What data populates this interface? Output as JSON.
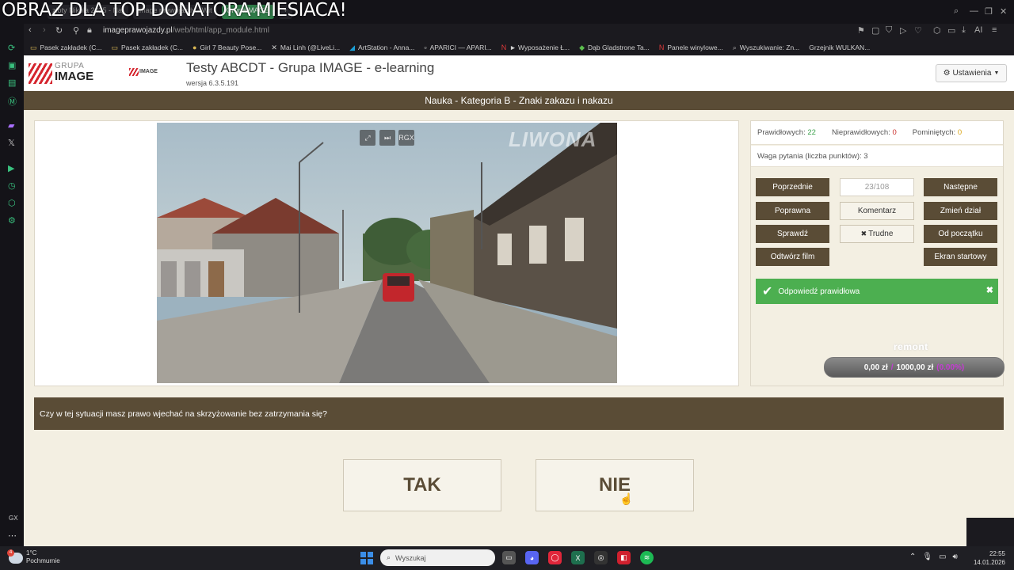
{
  "overlay": {
    "title": "OBRAZ DLA TOP DONATORA MIESIACA!"
  },
  "browser": {
    "tabs": [
      {
        "label": "złoty Nikola 2025 - Naj"
      },
      {
        "label": "image prawojazdy - Wit"
      },
      {
        "label": "GrupaIMAGE"
      }
    ],
    "url_domain": "imageprawojazdy.pl",
    "url_path": "/web/html/app_module.html",
    "ai_label": "AI"
  },
  "bookmarks": [
    {
      "label": "Pasek zakładek (C...",
      "icon": "folder-icon"
    },
    {
      "label": "Pasek zakładek (C...",
      "icon": "folder-icon"
    },
    {
      "label": "Girl 7 Beauty Pose...",
      "icon": "site-icon"
    },
    {
      "label": "Mai Linh (@LiveLi...",
      "icon": "x-icon"
    },
    {
      "label": "ArtStation - Anna...",
      "icon": "artstation-icon"
    },
    {
      "label": "APARICI — APARI...",
      "icon": "site-icon"
    },
    {
      "label": "► Wyposażenie Ł...",
      "icon": "n-icon"
    },
    {
      "label": "Dąb Gladstrone Ta...",
      "icon": "diamond-icon"
    },
    {
      "label": "Panele winylowe...",
      "icon": "n-icon"
    },
    {
      "label": "Wyszukiwanie: Zn...",
      "icon": "search-icon"
    },
    {
      "label": "Grzejnik WULKAN...",
      "icon": "site-icon"
    }
  ],
  "header": {
    "logo_top": "GRUPA",
    "logo_bottom": "IMAGE",
    "logo2": "IMAGE",
    "title": "Testy ABCDT - Grupa IMAGE - e-learning",
    "version": "wersja 6.3.5.191",
    "settings_label": "Ustawienia"
  },
  "category": "Nauka - Kategoria B - Znaki zakazu i nakazu",
  "video": {
    "watermark": "LIWONA",
    "rgx_label": "RGX"
  },
  "stats": {
    "correct_label": "Prawidłowych:",
    "correct_value": "22",
    "incorrect_label": "Nieprawidłowych:",
    "incorrect_value": "0",
    "skipped_label": "Pominiętych:",
    "skipped_value": "0",
    "weight": "Waga pytania (liczba punktów): 3"
  },
  "controls": {
    "previous": "Poprzednie",
    "counter": "23/108",
    "next": "Następne",
    "correct": "Poprawna",
    "comment": "Komentarz",
    "change_section": "Zmień dział",
    "check": "Sprawdź",
    "hard": "Trudne",
    "from_start": "Od początku",
    "play_film": "Odtwórz film",
    "start_screen": "Ekran startowy"
  },
  "alert": {
    "text": "Odpowiedź prawidłowa"
  },
  "donation": {
    "label": "remont",
    "current": "0,00 zł",
    "separator": "/",
    "goal": "1000,00 zł",
    "percent": "(0.00%)"
  },
  "question": "Czy w tej sytuacji masz prawo wjechać na skrzyżowanie bez zatrzymania się?",
  "answers": {
    "yes": "TAK",
    "no": "NIE"
  },
  "sidebar_bottom_label": "GX",
  "taskbar": {
    "temp": "1°C",
    "weather": "Pochmurnie",
    "badge": "4",
    "search_placeholder": "Wyszukaj",
    "time": "22:55",
    "date": "14.01.2026"
  }
}
